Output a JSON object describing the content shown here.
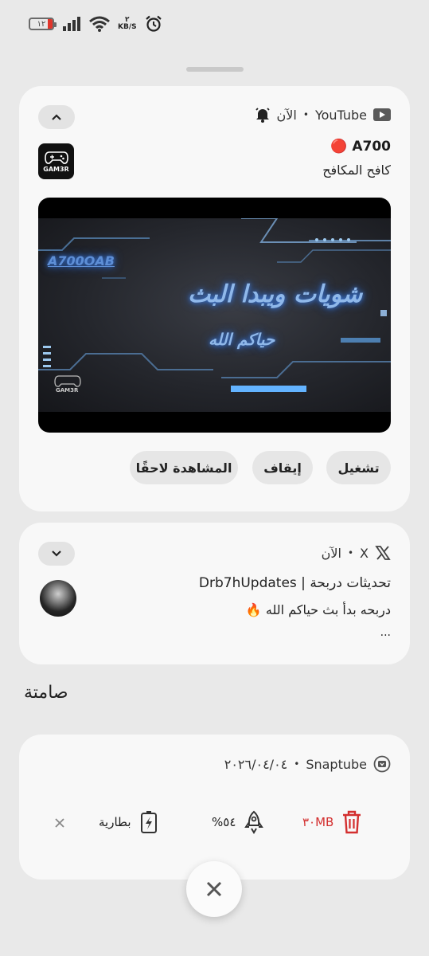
{
  "status_bar": {
    "battery_level": "١٢",
    "network_speed_value": "٢",
    "network_speed_unit": "KB/S",
    "icons": [
      "battery-icon",
      "signal-icon",
      "wifi-icon",
      "alarm-icon"
    ]
  },
  "youtube_notification": {
    "app_name": "YouTube",
    "time": "الآن",
    "separator": "•",
    "title": "A700 🔴",
    "subtitle": "كافح المكافح",
    "thumbnail_text": "GAM3R",
    "video": {
      "watermark": "A700OAB",
      "line1": "شويات ويبدا البث",
      "line2": "حياكم الله",
      "logo_text": "GAM3R"
    },
    "actions": {
      "play": "تشغيل",
      "stop": "إيقاف",
      "watch_later": "المشاهدة لاحقًا"
    }
  },
  "x_notification": {
    "app_name": "X",
    "time": "الآن",
    "separator": "•",
    "title": "تحديثات دربحة | Drb7hUpdates",
    "text": "دربحه بدأ بث حياكم الله 🔥",
    "more": "..."
  },
  "silent_section": {
    "title": "صامتة"
  },
  "snaptube_notification": {
    "app_name": "Snaptube",
    "date": "٢٠٢٦/٠٤/٠٤",
    "separator": "•",
    "storage_value": "٣٠MB",
    "boost_value": "%٥٤",
    "battery_label": "بطارية"
  },
  "colors": {
    "background": "#e9e9e9",
    "card": "#f8f8f8",
    "storage_red": "#d32f2f",
    "video_glow": "#3c78d8"
  }
}
